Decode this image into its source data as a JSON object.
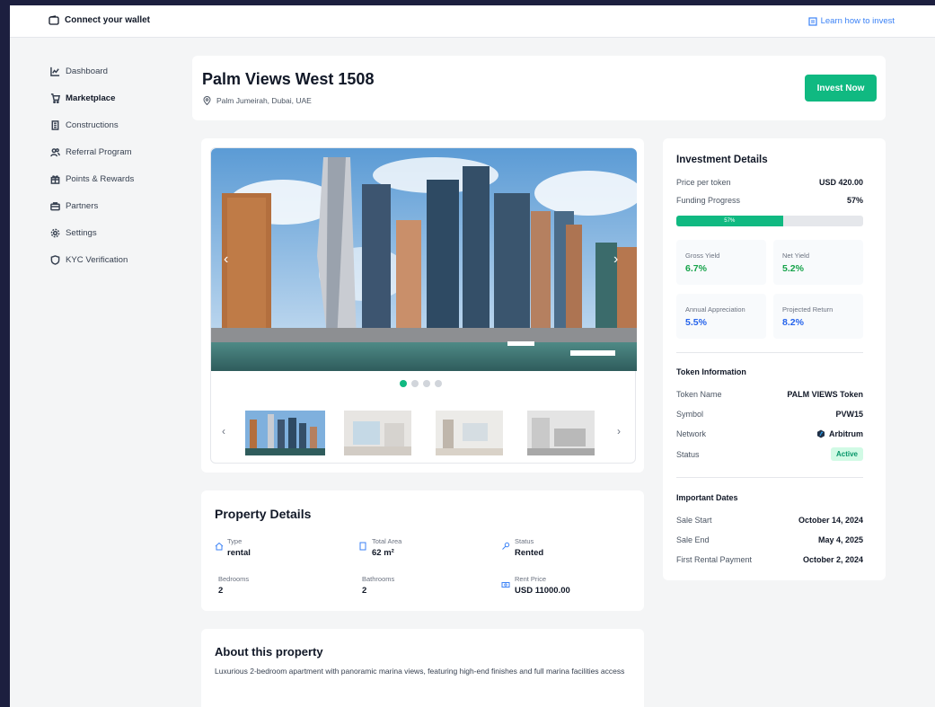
{
  "topbar": {
    "wallet_label": "Connect your wallet",
    "learn_label": "Learn how to invest"
  },
  "sidebar": {
    "items": [
      {
        "label": "Dashboard",
        "icon": "chart-line-icon",
        "active": false
      },
      {
        "label": "Marketplace",
        "icon": "cart-icon",
        "active": true
      },
      {
        "label": "Constructions",
        "icon": "building-icon",
        "active": false
      },
      {
        "label": "Referral Program",
        "icon": "users-icon",
        "active": false
      },
      {
        "label": "Points & Rewards",
        "icon": "gift-icon",
        "active": false
      },
      {
        "label": "Partners",
        "icon": "briefcase-icon",
        "active": false
      },
      {
        "label": "Settings",
        "icon": "gear-icon",
        "active": false
      },
      {
        "label": "KYC Verification",
        "icon": "shield-icon",
        "active": false
      }
    ]
  },
  "header": {
    "title": "Palm Views West 1508",
    "location": "Palm Jumeirah, Dubai, UAE",
    "invest_label": "Invest Now"
  },
  "property": {
    "title": "Property Details",
    "type_label": "Type",
    "type_value": "rental",
    "area_label": "Total Area",
    "area_value": "62 m²",
    "status_label": "Status",
    "status_value": "Rented",
    "bedrooms_label": "Bedrooms",
    "bedrooms_value": "2",
    "bathrooms_label": "Bathrooms",
    "bathrooms_value": "2",
    "rent_label": "Rent Price",
    "rent_value": "USD 11000.00"
  },
  "about": {
    "title": "About this property",
    "text": "Luxurious 2-bedroom apartment with panoramic marina views, featuring high-end finishes and full marina facilities access"
  },
  "investment": {
    "title": "Investment Details",
    "price_label": "Price per token",
    "price_value": "USD 420.00",
    "funding_label": "Funding Progress",
    "funding_value": "57%",
    "funding_fraction": 0.57,
    "bar_label": "57%",
    "gross_label": "Gross Yield",
    "gross_value": "6.7%",
    "net_label": "Net Yield",
    "net_value": "5.2%",
    "appreciation_label": "Annual Appreciation",
    "appreciation_value": "5.5%",
    "return_label": "Projected Return",
    "return_value": "8.2%",
    "token_title": "Token Information",
    "token_name_label": "Token Name",
    "token_name_value": "PALM VIEWS Token",
    "symbol_label": "Symbol",
    "symbol_value": "PVW15",
    "network_label": "Network",
    "network_value": "Arbitrum",
    "status_label": "Status",
    "status_value": "Active",
    "dates_title": "Important Dates",
    "sale_start_label": "Sale Start",
    "sale_start_value": "October 14, 2024",
    "sale_end_label": "Sale End",
    "sale_end_value": "May 4, 2025",
    "first_rent_label": "First Rental Payment",
    "first_rent_value": "October 2, 2024"
  },
  "colors": {
    "accent": "#10b981",
    "link": "#3b82f6",
    "yield_green": "#16a34a",
    "yield_blue": "#2563eb"
  }
}
